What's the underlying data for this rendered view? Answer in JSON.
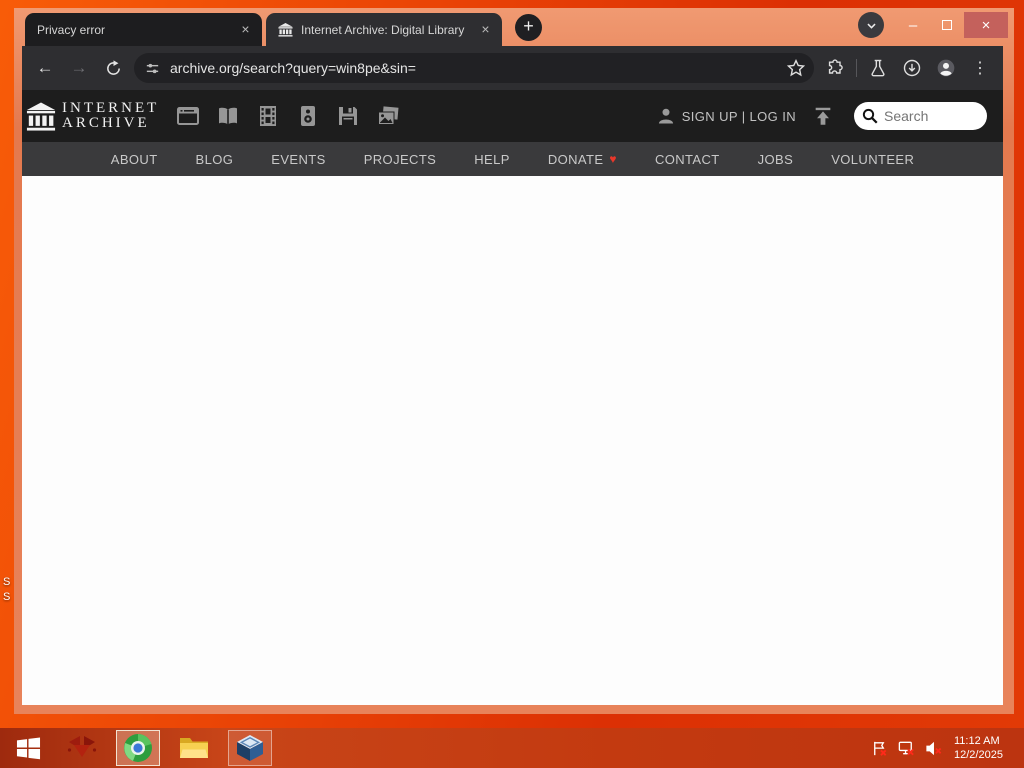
{
  "desktop": {
    "labels": [
      "S",
      "S"
    ]
  },
  "glyphs": {
    "close": "×",
    "plus": "+",
    "minimize": "–",
    "menu_dots": "⋮",
    "back": "←",
    "forward": "→",
    "heart": "♥"
  },
  "browser": {
    "tabs": [
      {
        "title": "Privacy error",
        "active": false
      },
      {
        "title": "Internet Archive: Digital Library",
        "active": true,
        "favicon": "internet-archive-building"
      }
    ],
    "address_bar": {
      "url": "archive.org/search?query=win8pe&sin="
    },
    "toolbar_icons": [
      "back",
      "forward",
      "reload",
      "site-settings-tune",
      "bookmark-star",
      "extensions-puzzle",
      "labs-flask",
      "download",
      "profile-avatar",
      "menu-dots"
    ]
  },
  "page": {
    "header": {
      "logo_line1": "INTERNET",
      "logo_line2": "ARCHIVE",
      "media_icons": [
        "web",
        "texts",
        "video",
        "audio",
        "software",
        "images"
      ],
      "auth": "SIGN UP | LOG IN",
      "search_placeholder": "Search"
    },
    "nav": {
      "items": [
        "ABOUT",
        "BLOG",
        "EVENTS",
        "PROJECTS",
        "HELP",
        "DONATE",
        "CONTACT",
        "JOBS",
        "VOLUNTEER"
      ]
    }
  },
  "taskbar": {
    "time": "11:12 AM",
    "date": "12/2/2025",
    "apps": [
      "windows-start",
      "red-app",
      "green-browser",
      "file-explorer",
      "virtualbox"
    ],
    "tray": [
      "action-center-flag",
      "network-disconnected",
      "volume-muted"
    ]
  },
  "colors": {
    "desktop_orange": "#ea4406",
    "taskbar_red": "#c33a10",
    "frame_salmon": "#e8835a",
    "toolbar_dark": "#2e2e31",
    "tab_inactive": "#1d1d1f",
    "header_dark": "#1d1d1d",
    "nav_dark": "#3a3a3c",
    "donate_heart": "#ea372a",
    "close_button": "#c4615c",
    "icon_gray": "#969696"
  }
}
